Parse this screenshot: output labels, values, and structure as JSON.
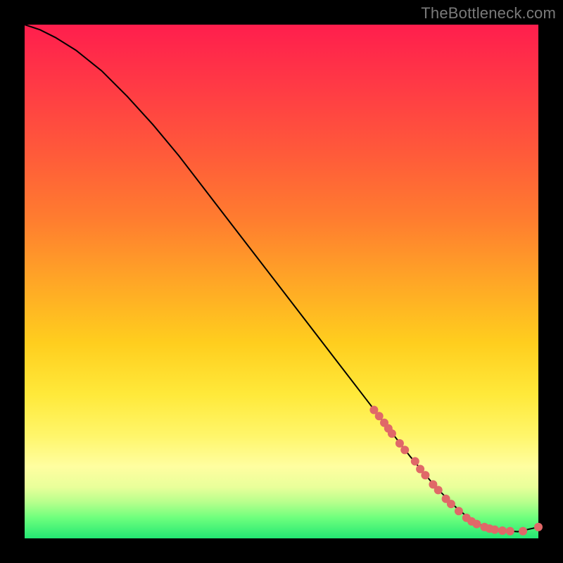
{
  "watermark": "TheBottleneck.com",
  "chart_data": {
    "type": "line",
    "title": "",
    "xlabel": "",
    "ylabel": "",
    "xlim": [
      0,
      100
    ],
    "ylim": [
      0,
      100
    ],
    "grid": false,
    "legend": false,
    "series": [
      {
        "name": "curve",
        "color": "#000000",
        "x": [
          0,
          3,
          6,
          10,
          15,
          20,
          25,
          30,
          35,
          40,
          45,
          50,
          55,
          60,
          65,
          70,
          75,
          80,
          84,
          87,
          90,
          93,
          96,
          100
        ],
        "values": [
          100,
          99,
          97.5,
          95,
          91,
          86,
          80.5,
          74.5,
          68,
          61.5,
          55,
          48.5,
          42,
          35.5,
          29,
          22.5,
          16,
          10,
          6,
          3.5,
          2,
          1.5,
          1.3,
          2.2
        ]
      }
    ],
    "markers": {
      "name": "highlighted-points",
      "color": "#e06868",
      "radius_px": 6,
      "points": [
        {
          "x": 68,
          "y": 25
        },
        {
          "x": 69,
          "y": 23.8
        },
        {
          "x": 70,
          "y": 22.5
        },
        {
          "x": 70.8,
          "y": 21.4
        },
        {
          "x": 71.5,
          "y": 20.4
        },
        {
          "x": 73,
          "y": 18.5
        },
        {
          "x": 74,
          "y": 17.2
        },
        {
          "x": 76,
          "y": 15
        },
        {
          "x": 77,
          "y": 13.5
        },
        {
          "x": 78,
          "y": 12.3
        },
        {
          "x": 79.5,
          "y": 10.5
        },
        {
          "x": 80.5,
          "y": 9.4
        },
        {
          "x": 82,
          "y": 7.7
        },
        {
          "x": 83,
          "y": 6.7
        },
        {
          "x": 84.5,
          "y": 5.3
        },
        {
          "x": 86,
          "y": 4
        },
        {
          "x": 87,
          "y": 3.3
        },
        {
          "x": 88,
          "y": 2.8
        },
        {
          "x": 89.5,
          "y": 2.2
        },
        {
          "x": 90.5,
          "y": 1.9
        },
        {
          "x": 91.5,
          "y": 1.7
        },
        {
          "x": 93,
          "y": 1.5
        },
        {
          "x": 94.5,
          "y": 1.4
        },
        {
          "x": 97,
          "y": 1.4
        },
        {
          "x": 100,
          "y": 2.2
        }
      ]
    }
  }
}
